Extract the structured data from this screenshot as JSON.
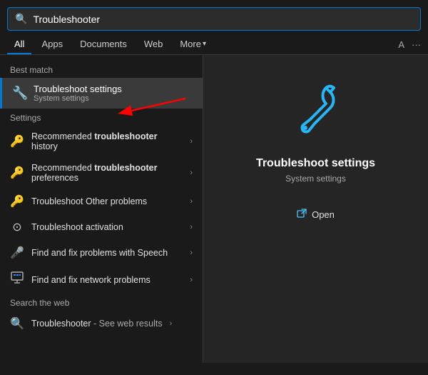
{
  "search": {
    "placeholder": "Troubleshooter",
    "value": "Troubleshooter",
    "icon": "search-icon"
  },
  "nav": {
    "tabs": [
      {
        "id": "all",
        "label": "All",
        "active": true
      },
      {
        "id": "apps",
        "label": "Apps",
        "active": false
      },
      {
        "id": "documents",
        "label": "Documents",
        "active": false
      },
      {
        "id": "web",
        "label": "Web",
        "active": false
      },
      {
        "id": "more",
        "label": "More",
        "active": false
      }
    ],
    "right": {
      "a_label": "A",
      "more_label": "···"
    }
  },
  "best_match": {
    "label": "Best match",
    "item": {
      "title": "Troubleshoot settings",
      "subtitle": "System settings",
      "icon": "settings-icon"
    }
  },
  "settings_section": {
    "label": "Settings",
    "items": [
      {
        "icon": "key-icon",
        "text_before": "Recommended ",
        "text_bold": "troubleshooter",
        "text_after": " history"
      },
      {
        "icon": "key-icon",
        "text_before": "Recommended ",
        "text_bold": "troubleshooter",
        "text_after": " preferences"
      },
      {
        "icon": "key-icon",
        "text_before": "Troubleshoot Other problems",
        "text_bold": "",
        "text_after": ""
      },
      {
        "icon": "circle-icon",
        "text_before": "Troubleshoot activation",
        "text_bold": "",
        "text_after": ""
      },
      {
        "icon": "mic-icon",
        "text_before": "Find and fix problems with Speech",
        "text_bold": "",
        "text_after": ""
      },
      {
        "icon": "network-icon",
        "text_before": "Find and fix network problems",
        "text_bold": "",
        "text_after": ""
      }
    ]
  },
  "search_web": {
    "label": "Search the web",
    "item": {
      "query": "Troubleshooter",
      "suffix": " - See web results"
    }
  },
  "right_panel": {
    "title": "Troubleshoot settings",
    "subtitle": "System settings",
    "open_label": "Open"
  }
}
